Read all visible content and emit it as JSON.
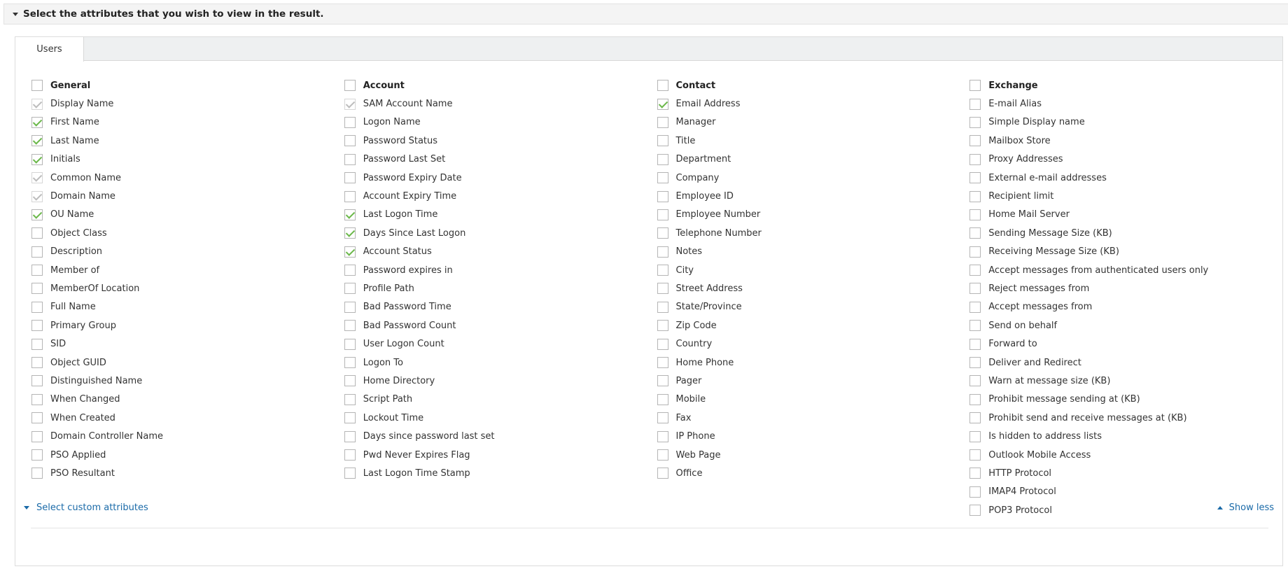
{
  "section": {
    "title": "Select the attributes that you wish to view in the result."
  },
  "tabs": [
    {
      "label": "Users"
    }
  ],
  "colors": {
    "check": "#6bb84a",
    "link": "#1a6aa8"
  },
  "columns": [
    {
      "header": "General",
      "items": [
        {
          "label": "Display Name",
          "state": "disabled-checked"
        },
        {
          "label": "First Name",
          "state": "checked"
        },
        {
          "label": "Last Name",
          "state": "checked"
        },
        {
          "label": "Initials",
          "state": "checked"
        },
        {
          "label": "Common Name",
          "state": "disabled-checked"
        },
        {
          "label": "Domain Name",
          "state": "disabled-checked"
        },
        {
          "label": "OU Name",
          "state": "checked"
        },
        {
          "label": "Object Class",
          "state": "unchecked"
        },
        {
          "label": "Description",
          "state": "unchecked"
        },
        {
          "label": "Member of",
          "state": "unchecked"
        },
        {
          "label": "MemberOf Location",
          "state": "unchecked"
        },
        {
          "label": "Full Name",
          "state": "unchecked"
        },
        {
          "label": "Primary Group",
          "state": "unchecked"
        },
        {
          "label": "SID",
          "state": "unchecked"
        },
        {
          "label": "Object GUID",
          "state": "unchecked"
        },
        {
          "label": "Distinguished Name",
          "state": "unchecked"
        },
        {
          "label": "When Changed",
          "state": "unchecked"
        },
        {
          "label": "When Created",
          "state": "unchecked"
        },
        {
          "label": "Domain Controller Name",
          "state": "unchecked"
        },
        {
          "label": "PSO Applied",
          "state": "unchecked"
        },
        {
          "label": "PSO Resultant",
          "state": "unchecked"
        }
      ]
    },
    {
      "header": "Account",
      "items": [
        {
          "label": "SAM Account Name",
          "state": "disabled-checked"
        },
        {
          "label": "Logon Name",
          "state": "unchecked"
        },
        {
          "label": "Password Status",
          "state": "unchecked"
        },
        {
          "label": "Password Last Set",
          "state": "unchecked"
        },
        {
          "label": "Password Expiry Date",
          "state": "unchecked"
        },
        {
          "label": "Account Expiry Time",
          "state": "unchecked"
        },
        {
          "label": "Last Logon Time",
          "state": "checked"
        },
        {
          "label": "Days Since Last Logon",
          "state": "checked"
        },
        {
          "label": "Account Status",
          "state": "checked"
        },
        {
          "label": "Password expires in",
          "state": "unchecked"
        },
        {
          "label": "Profile Path",
          "state": "unchecked"
        },
        {
          "label": "Bad Password Time",
          "state": "unchecked"
        },
        {
          "label": "Bad Password Count",
          "state": "unchecked"
        },
        {
          "label": "User Logon Count",
          "state": "unchecked"
        },
        {
          "label": "Logon To",
          "state": "unchecked"
        },
        {
          "label": "Home Directory",
          "state": "unchecked"
        },
        {
          "label": "Script Path",
          "state": "unchecked"
        },
        {
          "label": "Lockout Time",
          "state": "unchecked"
        },
        {
          "label": "Days since password last set",
          "state": "unchecked"
        },
        {
          "label": "Pwd Never Expires Flag",
          "state": "unchecked"
        },
        {
          "label": "Last Logon Time Stamp",
          "state": "unchecked"
        }
      ]
    },
    {
      "header": "Contact",
      "items": [
        {
          "label": "Email Address",
          "state": "checked"
        },
        {
          "label": "Manager",
          "state": "unchecked"
        },
        {
          "label": "Title",
          "state": "unchecked"
        },
        {
          "label": "Department",
          "state": "unchecked"
        },
        {
          "label": "Company",
          "state": "unchecked"
        },
        {
          "label": "Employee ID",
          "state": "unchecked"
        },
        {
          "label": "Employee Number",
          "state": "unchecked"
        },
        {
          "label": "Telephone Number",
          "state": "unchecked"
        },
        {
          "label": "Notes",
          "state": "unchecked"
        },
        {
          "label": "City",
          "state": "unchecked"
        },
        {
          "label": "Street Address",
          "state": "unchecked"
        },
        {
          "label": "State/Province",
          "state": "unchecked"
        },
        {
          "label": "Zip Code",
          "state": "unchecked"
        },
        {
          "label": "Country",
          "state": "unchecked"
        },
        {
          "label": "Home Phone",
          "state": "unchecked"
        },
        {
          "label": "Pager",
          "state": "unchecked"
        },
        {
          "label": "Mobile",
          "state": "unchecked"
        },
        {
          "label": "Fax",
          "state": "unchecked"
        },
        {
          "label": "IP Phone",
          "state": "unchecked"
        },
        {
          "label": "Web Page",
          "state": "unchecked"
        },
        {
          "label": "Office",
          "state": "unchecked"
        }
      ]
    },
    {
      "header": "Exchange",
      "items": [
        {
          "label": "E-mail Alias",
          "state": "unchecked"
        },
        {
          "label": "Simple Display name",
          "state": "unchecked"
        },
        {
          "label": "Mailbox Store",
          "state": "unchecked"
        },
        {
          "label": "Proxy Addresses",
          "state": "unchecked"
        },
        {
          "label": "External e-mail addresses",
          "state": "unchecked"
        },
        {
          "label": "Recipient limit",
          "state": "unchecked"
        },
        {
          "label": "Home Mail Server",
          "state": "unchecked"
        },
        {
          "label": "Sending Message Size (KB)",
          "state": "unchecked"
        },
        {
          "label": "Receiving Message Size (KB)",
          "state": "unchecked"
        },
        {
          "label": "Accept messages from authenticated users only",
          "state": "unchecked"
        },
        {
          "label": "Reject messages from",
          "state": "unchecked"
        },
        {
          "label": "Accept messages from",
          "state": "unchecked"
        },
        {
          "label": "Send on behalf",
          "state": "unchecked"
        },
        {
          "label": "Forward to",
          "state": "unchecked"
        },
        {
          "label": "Deliver and Redirect",
          "state": "unchecked"
        },
        {
          "label": "Warn at message size (KB)",
          "state": "unchecked"
        },
        {
          "label": "Prohibit message sending at (KB)",
          "state": "unchecked"
        },
        {
          "label": "Prohibit send and receive messages at (KB)",
          "state": "unchecked"
        },
        {
          "label": "Is hidden to address lists",
          "state": "unchecked"
        },
        {
          "label": "Outlook Mobile Access",
          "state": "unchecked"
        },
        {
          "label": "HTTP Protocol",
          "state": "unchecked"
        },
        {
          "label": "IMAP4 Protocol",
          "state": "unchecked"
        },
        {
          "label": "POP3 Protocol",
          "state": "unchecked"
        }
      ]
    }
  ],
  "footer": {
    "custom_label": "Select custom attributes",
    "show_less_label": "Show less"
  }
}
